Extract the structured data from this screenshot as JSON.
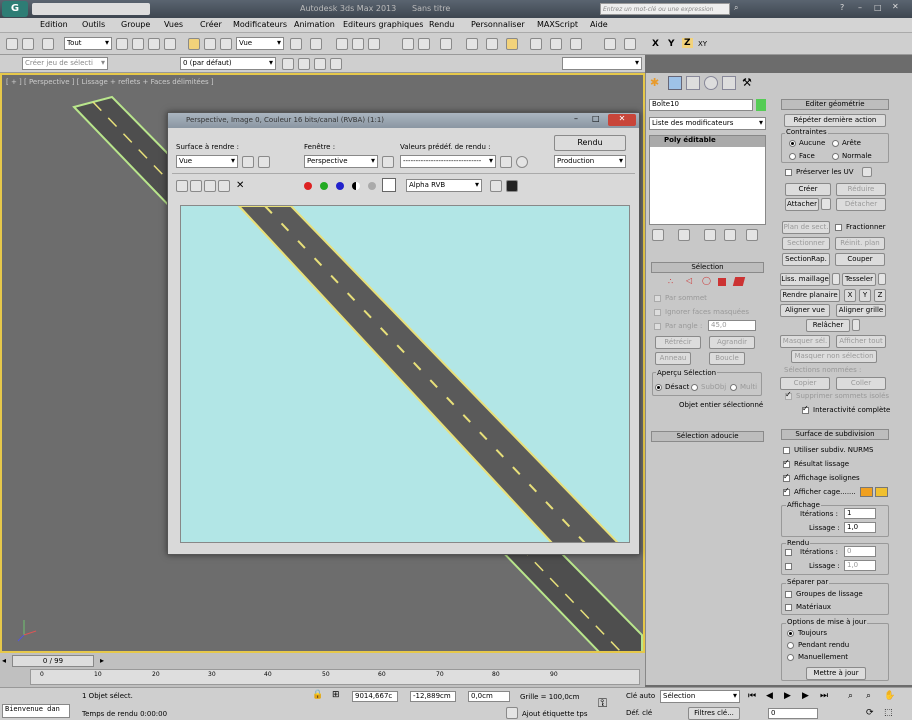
{
  "app": {
    "title": "Autodesk 3ds Max 2013",
    "doc": "Sans titre",
    "search_placeholder": "Entrez un mot-clé ou une expression"
  },
  "menu": [
    "Edition",
    "Outils",
    "Groupe",
    "Vues",
    "Créer",
    "Modificateurs",
    "Animation",
    "Editeurs graphiques",
    "Rendu",
    "Personnaliser",
    "MAXScript",
    "Aide"
  ],
  "toolbar": {
    "filter": "Tout",
    "ref_coord": "Vue",
    "axes": [
      "X",
      "Y",
      "Z",
      "XY"
    ]
  },
  "toolbar2": {
    "selection_set": "Créer jeu de sélecti",
    "layer": "0 (par défaut)"
  },
  "viewport": {
    "label": "[ + ] [ Perspective ] [ Lissage + reflets + Faces délimitées ]"
  },
  "render_window": {
    "title": "Perspective, Image 0, Couleur 16 bits/canal (RVBA) (1:1)",
    "area_label": "Surface à rendre :",
    "area_value": "Vue",
    "viewport_label": "Fenêtre :",
    "viewport_value": "Perspective",
    "preset_label": "Valeurs prédéf. de rendu :",
    "preset_value": "-------------------------------",
    "render_button": "Rendu",
    "mode_value": "Production",
    "channel_value": "Alpha RVB"
  },
  "command_panel": {
    "object_name": "Boîte10",
    "modifier_list": "Liste des modificateurs",
    "stack_item": "Poly éditable",
    "selection": {
      "head": "Sélection",
      "par_sommet": "Par sommet",
      "ignorer": "Ignorer faces masquées",
      "par_angle": "Par angle :",
      "angle_value": "45,0",
      "retrecir": "Rétrécir",
      "agrandir": "Agrandir",
      "anneau": "Anneau",
      "boucle": "Boucle",
      "apercu": "Aperçu Sélection",
      "desact": "Désact",
      "sous_obj": "SubObj",
      "multi": "Multi",
      "status": "Objet entier sélectionné"
    },
    "soft_selection": "Sélection adoucie",
    "edit_geometry": {
      "head": "Editer géométrie",
      "repeat": "Répéter dernière action",
      "contraintes": "Contraintes",
      "aucune": "Aucune",
      "arete": "Arête",
      "face": "Face",
      "normale": "Normale",
      "preserver": "Préserver les UV",
      "creer": "Créer",
      "reduire": "Réduire",
      "attacher": "Attacher",
      "detacher": "Détacher",
      "plan_sect": "Plan de sect.",
      "fractionner": "Fractionner",
      "sectionner": "Sectionner",
      "reinit_plan": "Réinit. plan",
      "section_rap": "SectionRap.",
      "couper": "Couper",
      "liss_maillage": "Liss. maillage",
      "tesseler": "Tesseler",
      "rendre_planaire": "Rendre planaire",
      "xyz": [
        "X",
        "Y",
        "Z"
      ],
      "aligner_vue": "Aligner vue",
      "aligner_grille": "Aligner grille",
      "relacher": "Relâcher",
      "masquer_sel": "Masquer sél.",
      "afficher_tout": "Afficher tout",
      "masquer_non_sel": "Masquer non sélection",
      "selections_nommees": "Sélections nommées :",
      "copier": "Copier",
      "coller": "Coller",
      "supprimer": "Supprimer sommets isolés",
      "interactivite": "Interactivité complète"
    },
    "subdivision": {
      "head": "Surface de subdivision",
      "nurms": "Utiliser subdiv. NURMS",
      "resultat": "Résultat lissage",
      "isolignes": "Affichage isolignes",
      "cage": "Afficher cage.......",
      "affichage": "Affichage",
      "iterations": "Itérations :",
      "iter_disp": "1",
      "lissage": "Lissage :",
      "liss_disp": "1,0",
      "rendu": "Rendu",
      "iter_render": "0",
      "liss_render": "1,0",
      "separer": "Séparer par",
      "groupes": "Groupes de lissage",
      "materiaux": "Matériaux",
      "options": "Options de mise à jour",
      "toujours": "Toujours",
      "pendant": "Pendant rendu",
      "manuel": "Manuellement",
      "mettre_a_jour": "Mettre à jour"
    }
  },
  "timeline": {
    "frame": "0 / 99",
    "ticks": [
      "0",
      "10",
      "20",
      "30",
      "40",
      "50",
      "60",
      "70",
      "80",
      "90"
    ]
  },
  "status": {
    "listener": "Bienvenue dan",
    "selected": "1 Objet sélect.",
    "render_time": "Temps de rendu  0:00:00",
    "x": "9014,667c",
    "y": "-12,889cm",
    "z": "0,0cm",
    "grid": "Grille = 100,0cm",
    "add_tag": "Ajout étiquette tps",
    "auto_key": "Clé auto",
    "set_key": "Déf. clé",
    "key_filter": "Sélection",
    "filters": "Filtres clé...",
    "frame_field": "0"
  },
  "colors": {
    "accent": "#e6c84a",
    "sky": "#b2e6e6",
    "road": "#5a5a5a",
    "stripe": "#e8e07a"
  }
}
